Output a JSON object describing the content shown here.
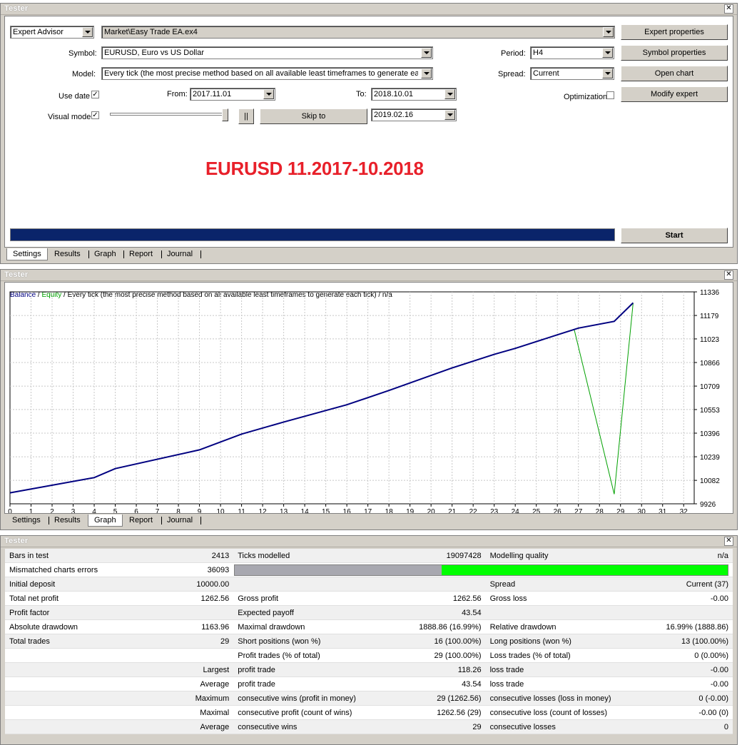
{
  "settings": {
    "title": "Tester",
    "mode_value": "Expert Advisor",
    "expert_value": "Market\\Easy Trade EA.ex4",
    "symbol_label": "Symbol:",
    "symbol_value": "EURUSD, Euro vs US Dollar",
    "model_label": "Model:",
    "model_value": "Every tick (the most precise method based on all available least timeframes to generate each tick)",
    "use_date_label": "Use date",
    "from_label": "From:",
    "from_value": "2017.11.01",
    "to_label": "To:",
    "to_value": "2018.10.01",
    "visual_mode_label": "Visual mode",
    "pause_label": "||",
    "skip_to_label": "Skip to",
    "skip_date": "2019.02.16",
    "period_label": "Period:",
    "period_value": "H4",
    "spread_label": "Spread:",
    "spread_value": "Current",
    "optimization_label": "Optimization",
    "expert_props": "Expert properties",
    "symbol_props": "Symbol properties",
    "open_chart": "Open chart",
    "modify_expert": "Modify expert",
    "start": "Start",
    "headline": "EURUSD 11.2017-10.2018",
    "headline_color": "#e8202a",
    "progress_color": "#0a246a"
  },
  "tabs": [
    "Settings",
    "Results",
    "Graph",
    "Report",
    "Journal"
  ],
  "graph": {
    "title": "Tester",
    "legend_balance": "Balance",
    "legend_sep": " / ",
    "legend_equity": "Equity",
    "legend_rest": " / Every tick (the most precise method based on all available least timeframes to generate each tick) / n/a",
    "balance_color": "#000080",
    "equity_color": "#00a000"
  },
  "chart_data": {
    "type": "line",
    "x_ticks": [
      "0",
      "1",
      "2",
      "3",
      "4",
      "5",
      "6",
      "7",
      "8",
      "9",
      "10",
      "11",
      "12",
      "13",
      "14",
      "15",
      "16",
      "17",
      "18",
      "19",
      "20",
      "21",
      "22",
      "23",
      "24",
      "25",
      "26",
      "27",
      "28",
      "29",
      "30",
      "31",
      "32"
    ],
    "y_ticks": [
      "11336",
      "11179",
      "11023",
      "10866",
      "10709",
      "10553",
      "10396",
      "10239",
      "10082",
      "9926"
    ],
    "ylim": [
      9926,
      11336
    ],
    "xlim": [
      0,
      32.5
    ],
    "series": [
      {
        "name": "Balance",
        "color": "#000080",
        "x": [
          0,
          4,
          5,
          9,
          11,
          13,
          16,
          18,
          21,
          23,
          24,
          26,
          27,
          28.7,
          29.6
        ],
        "y": [
          9999,
          10100,
          10160,
          10285,
          10390,
          10470,
          10585,
          10680,
          10830,
          10920,
          10960,
          11050,
          11095,
          11140,
          11263
        ]
      },
      {
        "name": "Equity",
        "color": "#00a000",
        "x": [
          0,
          4,
          5,
          9,
          11,
          13,
          16,
          18,
          21,
          23,
          24,
          26,
          26.8,
          28.7,
          29.6
        ],
        "y": [
          9999,
          10100,
          10160,
          10285,
          10390,
          10470,
          10585,
          10680,
          10830,
          10920,
          10960,
          11050,
          11086,
          9990,
          11263
        ]
      }
    ]
  },
  "report": {
    "title": "Tester",
    "rows": [
      [
        "Bars in test",
        "2413",
        "Ticks modelled",
        "19097428",
        "Modelling quality",
        "n/a"
      ],
      [
        "Mismatched charts errors",
        "36093",
        "",
        "",
        "",
        ""
      ],
      [
        "Initial deposit",
        "10000.00",
        "",
        "",
        "Spread",
        "Current (37)"
      ],
      [
        "Total net profit",
        "1262.56",
        "Gross profit",
        "1262.56",
        "Gross loss",
        "-0.00"
      ],
      [
        "Profit factor",
        "",
        "Expected payoff",
        "43.54",
        "",
        ""
      ],
      [
        "Absolute drawdown",
        "1163.96",
        "Maximal drawdown",
        "1888.86 (16.99%)",
        "Relative drawdown",
        "16.99% (1888.86)"
      ],
      [
        "Total trades",
        "29",
        "Short positions (won %)",
        "16 (100.00%)",
        "Long positions (won %)",
        "13 (100.00%)"
      ],
      [
        "",
        "",
        "Profit trades (% of total)",
        "29 (100.00%)",
        "Loss trades (% of total)",
        "0 (0.00%)"
      ],
      [
        "",
        "Largest",
        "profit trade",
        "118.26",
        "loss trade",
        "-0.00"
      ],
      [
        "",
        "Average",
        "profit trade",
        "43.54",
        "loss trade",
        "-0.00"
      ],
      [
        "",
        "Maximum",
        "consecutive wins (profit in money)",
        "29 (1262.56)",
        "consecutive losses (loss in money)",
        "0 (-0.00)"
      ],
      [
        "",
        "Maximal",
        "consecutive profit (count of wins)",
        "1262.56 (29)",
        "consecutive loss (count of losses)",
        "-0.00 (0)"
      ],
      [
        "",
        "Average",
        "consecutive wins",
        "29",
        "consecutive losses",
        "0"
      ]
    ],
    "quality_gray_color": "#a8a8b0",
    "quality_green_color": "#00ff00",
    "quality_green_fraction": 0.58
  }
}
